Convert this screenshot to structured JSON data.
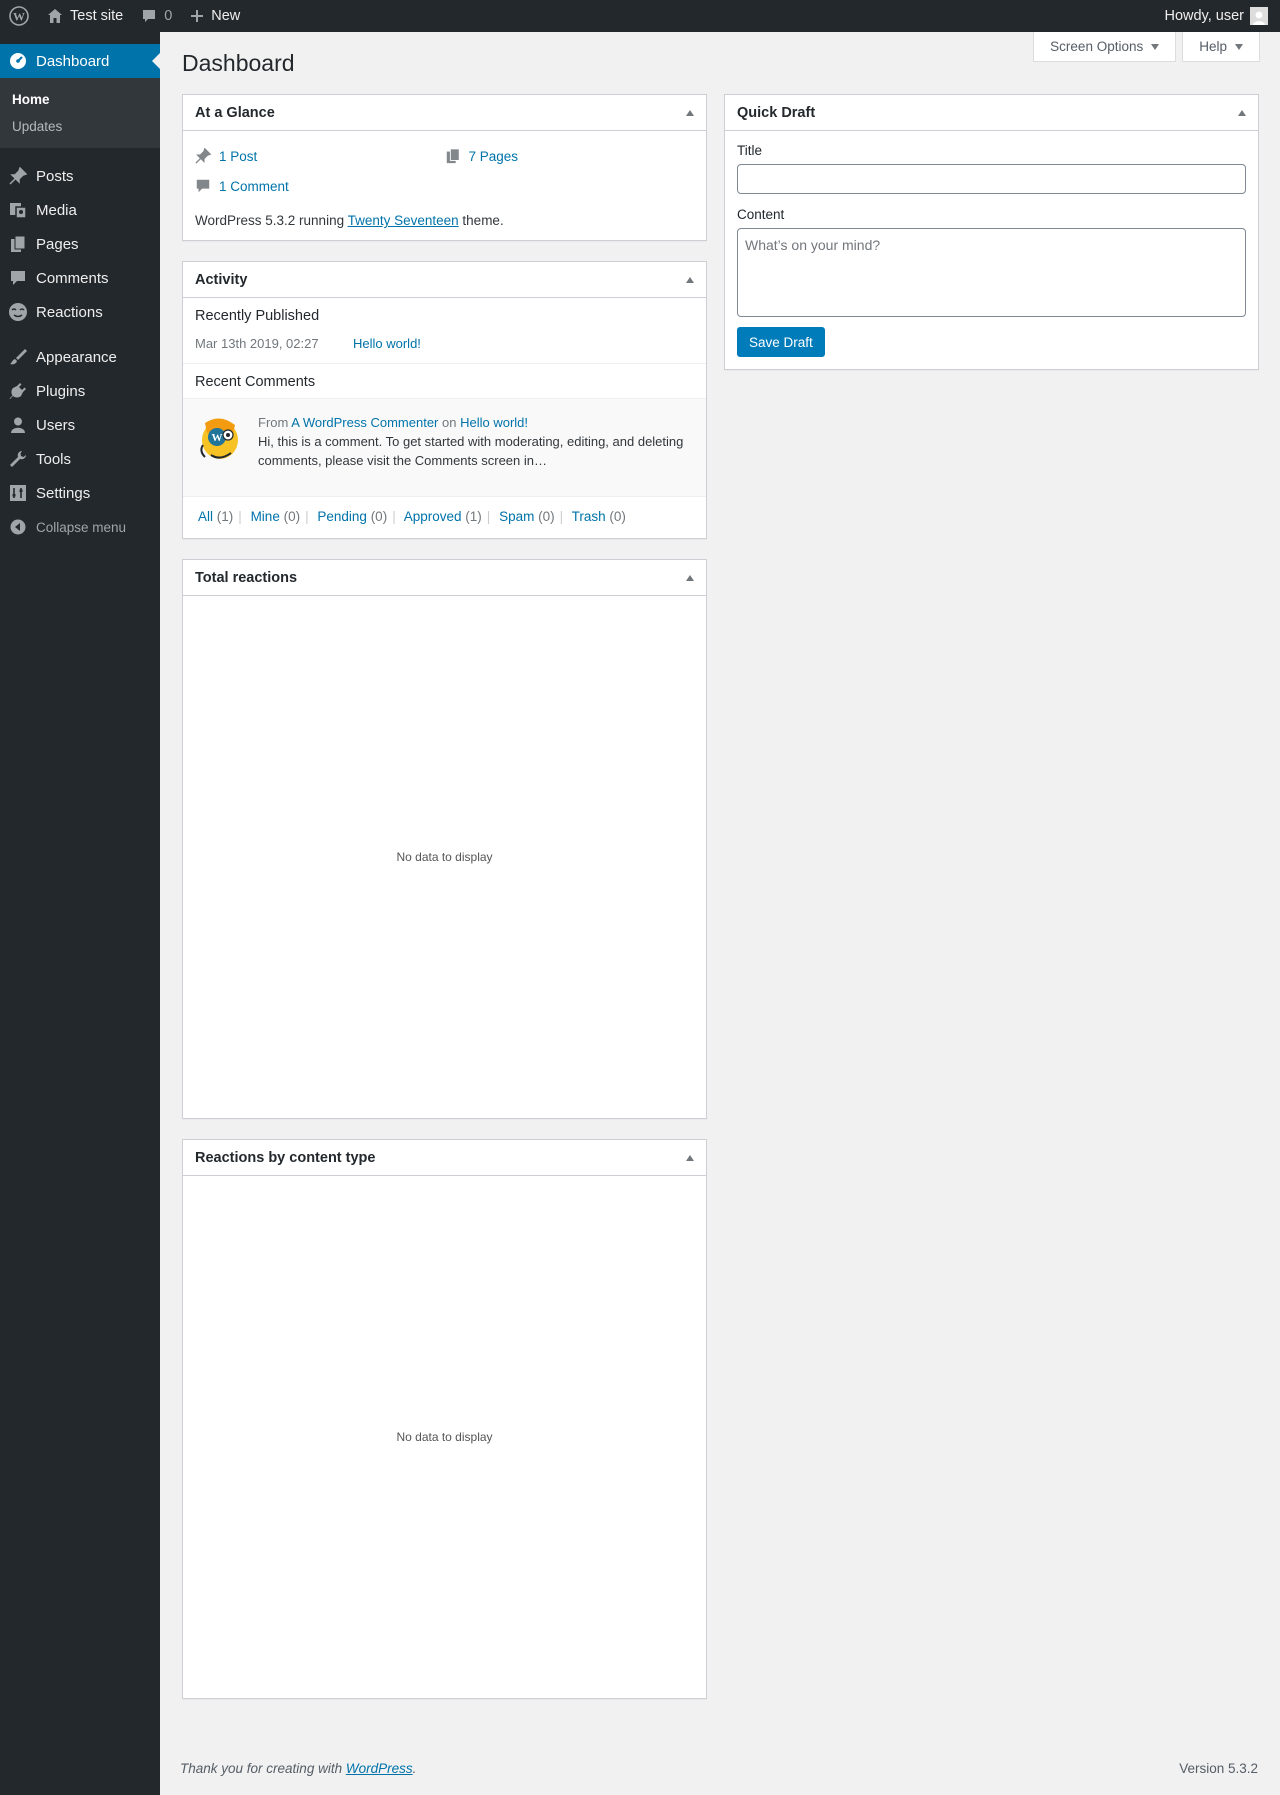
{
  "admin_bar": {
    "site_name": "Test site",
    "comments_count": "0",
    "new_label": "New",
    "greeting": "Howdy, user"
  },
  "sidebar": {
    "current": "Dashboard",
    "submenu": [
      "Home",
      "Updates"
    ],
    "items": [
      {
        "label": "Posts",
        "icon": "pin-icon"
      },
      {
        "label": "Media",
        "icon": "media-icon"
      },
      {
        "label": "Pages",
        "icon": "pages-icon"
      },
      {
        "label": "Comments",
        "icon": "comment-icon"
      },
      {
        "label": "Reactions",
        "icon": "reactions-icon"
      },
      {
        "label": "Appearance",
        "icon": "paintbrush-icon"
      },
      {
        "label": "Plugins",
        "icon": "plugin-icon"
      },
      {
        "label": "Users",
        "icon": "user-icon"
      },
      {
        "label": "Tools",
        "icon": "wrench-icon"
      },
      {
        "label": "Settings",
        "icon": "settings-icon"
      }
    ],
    "collapse_label": "Collapse menu"
  },
  "header": {
    "title": "Dashboard",
    "screen_options": "Screen Options",
    "help": "Help"
  },
  "glance": {
    "title": "At a Glance",
    "posts": "1 Post",
    "pages": "7 Pages",
    "comments": "1 Comment",
    "version_prefix": "WordPress 5.3.2 running ",
    "theme": "Twenty Seventeen",
    "version_suffix": " theme."
  },
  "activity": {
    "title": "Activity",
    "recently_published": "Recently Published",
    "pub_date": "Mar 13th 2019, 02:27",
    "pub_title": "Hello world!",
    "recent_comments": "Recent Comments",
    "comment_from": "From",
    "comment_author": "A WordPress Commenter",
    "comment_on": "on",
    "comment_post": "Hello world!",
    "comment_excerpt": "Hi, this is a comment. To get started with moderating, editing, and deleting comments, please visit the Comments screen in…",
    "filters": [
      {
        "label": "All",
        "count": "(1)"
      },
      {
        "label": "Mine",
        "count": "(0)"
      },
      {
        "label": "Pending",
        "count": "(0)"
      },
      {
        "label": "Approved",
        "count": "(1)"
      },
      {
        "label": "Spam",
        "count": "(0)"
      },
      {
        "label": "Trash",
        "count": "(0)"
      }
    ]
  },
  "total_reactions": {
    "title": "Total reactions",
    "empty": "No data to display"
  },
  "reactions_by_type": {
    "title": "Reactions by content type",
    "empty": "No data to display"
  },
  "quick_draft": {
    "title": "Quick Draft",
    "title_label": "Title",
    "content_label": "Content",
    "content_placeholder": "What’s on your mind?",
    "save_label": "Save Draft"
  },
  "footer": {
    "thanks_prefix": "Thank you for creating with ",
    "thanks_link": "WordPress",
    "thanks_suffix": ".",
    "version": "Version 5.3.2"
  },
  "colors": {
    "admin_bar": "#23282d",
    "sidebar": "#23282d",
    "accent": "#0073aa",
    "button": "#007cba",
    "background": "#f1f1f1"
  }
}
